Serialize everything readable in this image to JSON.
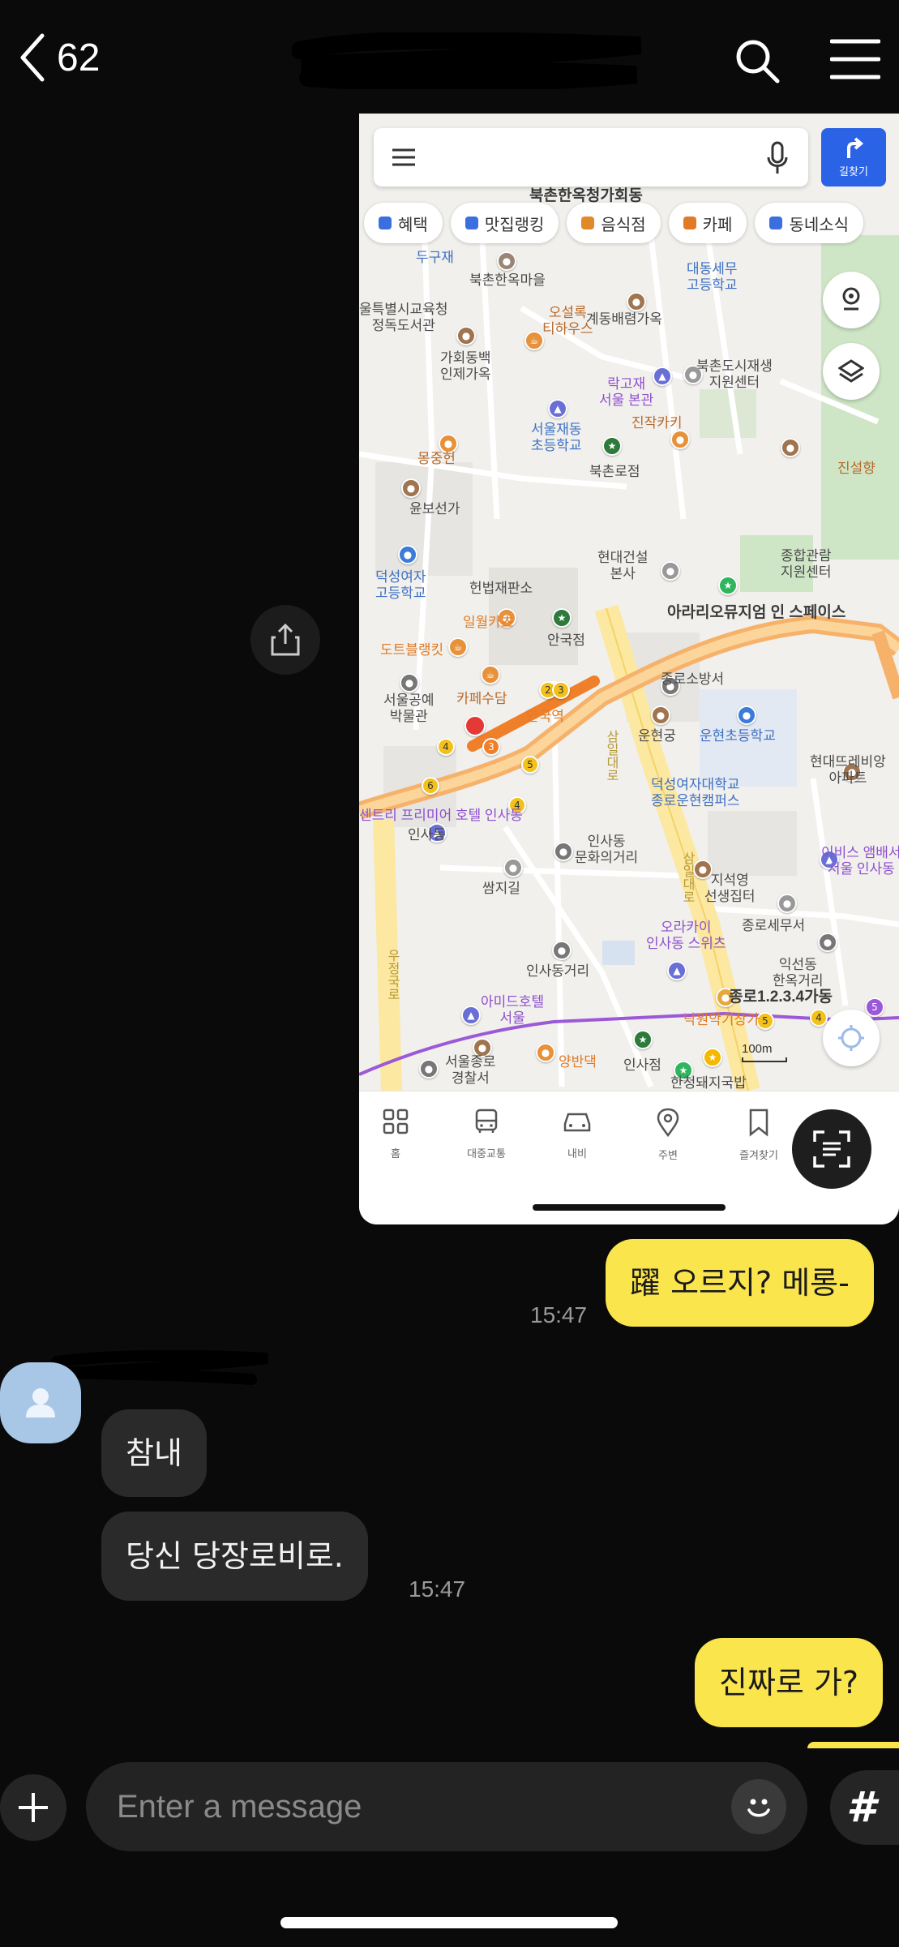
{
  "header": {
    "back_count": "62"
  },
  "map_screenshot": {
    "route_label": "길찾기",
    "chips": [
      "혜택",
      "맛집랭킹",
      "음식점",
      "카페",
      "동네소식"
    ],
    "chip_colors": [
      "#3b6fe0",
      "#3b6fe0",
      "#e08a2a",
      "#e07a26",
      "#3b6fe0"
    ],
    "labels": {
      "bukchon_hanok_village": "북촌한옥청가회동",
      "dugyejae": "두구재",
      "bukchon_maeul": "북촌한옥마을",
      "daedong_school": "대동세무\n고등학교",
      "jeongdok_library": "울특별시교육청\n정독도서관",
      "osulok": "오설록\n티하우스",
      "gyedong": "계동배렴가옥",
      "gahoe_injae": "가회동백\n인제가옥",
      "bukchon_regen": "북촌도시재생\n지원센터",
      "rakgojae": "락고재\n서울 본관",
      "jinjak": "진작카키",
      "jaedong_school": "서울재동\n초등학교",
      "bukchon_ro": "북촌로점",
      "mongjunghun": "몽중헌",
      "jinseolhyang": "진설향",
      "yunbo": "윤보선가",
      "hyundai": "현대건설\n본사",
      "jonghap": "종합관람\n지원센터",
      "duksung_high": "덕성여자\n고등학교",
      "court": "헌법재판소",
      "arario": "아라리오뮤지엄 인 스페이스",
      "ilwol": "일월카츠",
      "anguk_branch": "안국점",
      "dotbol": "도트블랭킷",
      "jongno_fire": "종로소방서",
      "craft_museum": "서울공예\n박물관",
      "cafe_sudam": "카페수담",
      "anguk_station": "안국역",
      "unhyeon": "운현궁",
      "unhyeon_school": "운현초등학교",
      "samil": "삼일대로",
      "hyundai_ribbon": "현대뜨레비앙\n아파트",
      "premier_hotel": "센트리 프리미어 호텔 인사동",
      "insadong1": "인사동",
      "duksung_campus": "덕성여자대학교\n종로운현캠퍼스",
      "insadong_culture": "인사동\n문화의거리",
      "ibis": "이비스 앰배서\n서울 인사동",
      "ssamziegil": "쌈지길",
      "jiseok": "지석영\n선생집터",
      "samil2": "삼일대로",
      "jongno_tax": "종로세무서",
      "insadong_st": "인사동거리",
      "orakai": "오라카이\n인사동 스위츠",
      "ikseon": "익선동\n한옥거리",
      "ujeongguk": "우정국로",
      "amid": "아미드호텔\n서울",
      "jongno_123": "종로1.2.3.4가동",
      "nagwon": "낙원악기상가",
      "jongno_police": "서울종로\n경찰서",
      "yangban": "양반댁",
      "insa_branch": "인사점",
      "hanchul": "한청돼지국밥"
    },
    "scale_label": "100m",
    "nav": [
      "홈",
      "대중교통",
      "내비",
      "주변",
      "즐겨찾기"
    ]
  },
  "messages": [
    {
      "text": "躍 오르지? 메롱-",
      "time": "15:47"
    },
    {
      "text": "참내"
    },
    {
      "text": "당신 당장로비로.",
      "time": "15:47"
    },
    {
      "text": "진짜로 가?"
    }
  ],
  "composer": {
    "placeholder": "Enter a message",
    "hash": "#"
  }
}
